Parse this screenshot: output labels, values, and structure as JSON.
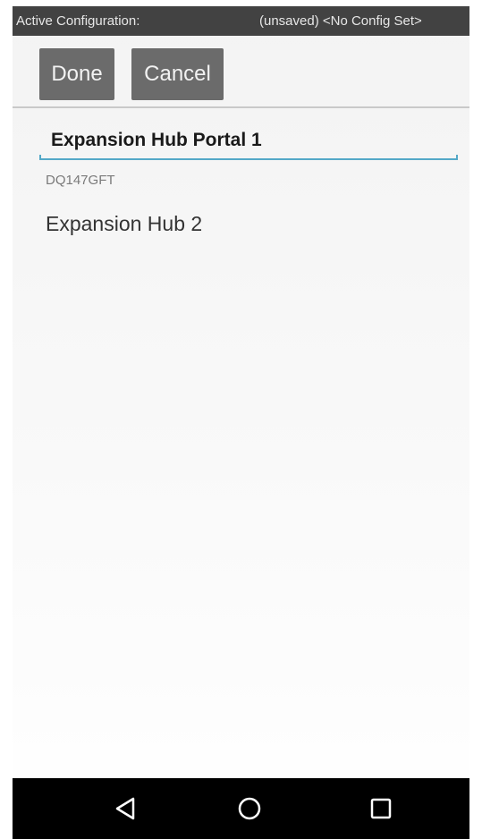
{
  "status_bar": {
    "label": "Active Configuration:",
    "value": "(unsaved) <No Config Set>"
  },
  "toolbar": {
    "done_label": "Done",
    "cancel_label": "Cancel"
  },
  "device": {
    "name": "Expansion Hub Portal 1",
    "serial": "DQ147GFT",
    "items": [
      "Expansion Hub 2"
    ]
  },
  "nav": {
    "back_icon": "back-triangle-icon",
    "home_icon": "home-circle-icon",
    "recent_icon": "recent-square-icon"
  },
  "colors": {
    "status_bar_bg": "#424242",
    "button_bg": "#6b6b6b",
    "field_underline": "#54a9c8",
    "nav_bar_bg": "#000000"
  }
}
